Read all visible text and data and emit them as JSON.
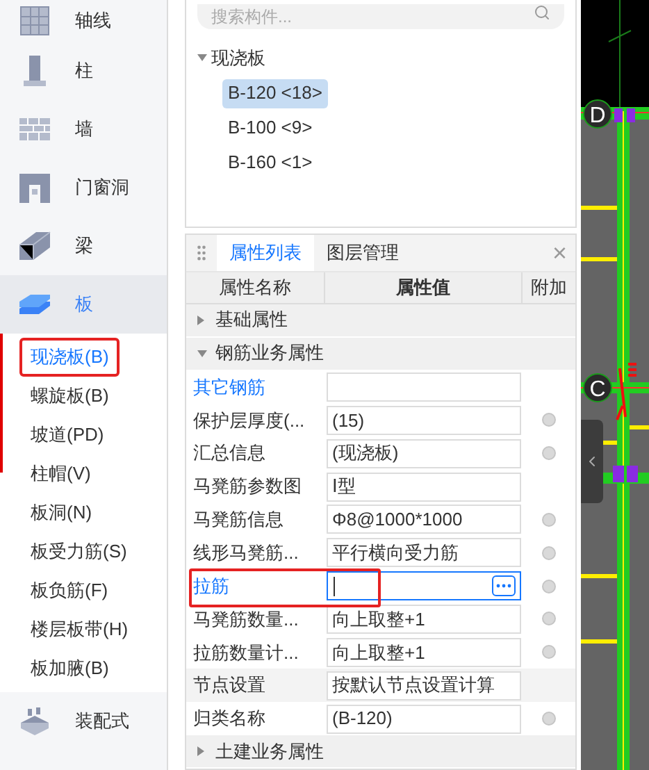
{
  "sidebar": {
    "categories": [
      {
        "label": "轴线",
        "kind": "grid",
        "selected": false
      },
      {
        "label": "柱",
        "kind": "column",
        "selected": false
      },
      {
        "label": "墙",
        "kind": "wall",
        "selected": false
      },
      {
        "label": "门窗洞",
        "kind": "door",
        "selected": false
      },
      {
        "label": "梁",
        "kind": "beam",
        "selected": false
      },
      {
        "label": "板",
        "kind": "slab",
        "selected": true,
        "children": [
          {
            "label": "现浇板(B)",
            "selected": true,
            "annotated": true
          },
          {
            "label": "螺旋板(B)",
            "selected": false,
            "annotated": false
          },
          {
            "label": "坡道(PD)",
            "selected": false,
            "annotated": false
          },
          {
            "label": "柱帽(V)",
            "selected": false,
            "annotated": false
          },
          {
            "label": "板洞(N)",
            "selected": false,
            "annotated": false
          },
          {
            "label": "板受力筋(S)",
            "selected": false,
            "annotated": false
          },
          {
            "label": "板负筋(F)",
            "selected": false,
            "annotated": false
          },
          {
            "label": "楼层板带(H)",
            "selected": false,
            "annotated": false
          },
          {
            "label": "板加腋(B)",
            "selected": false,
            "annotated": false
          }
        ]
      },
      {
        "label": "装配式",
        "kind": "prefab",
        "selected": false
      }
    ]
  },
  "component_list": {
    "search": {
      "placeholder": "搜索构件..."
    },
    "tree": {
      "label": "现浇板",
      "expanded": true,
      "children": [
        {
          "label": "B-120 <18>",
          "selected": true
        },
        {
          "label": "B-100 <9>",
          "selected": false
        },
        {
          "label": "B-160 <1>",
          "selected": false
        }
      ]
    }
  },
  "properties": {
    "tabs": [
      {
        "label": "属性列表",
        "selected": true
      },
      {
        "label": "图层管理",
        "selected": false
      }
    ],
    "close": "×",
    "columns": [
      "属性名称",
      "属性值",
      "附加"
    ],
    "rows": [
      {
        "kind": "group",
        "label": "基础属性",
        "expanded": false
      },
      {
        "kind": "group",
        "label": "钢筋业务属性",
        "expanded": true
      },
      {
        "kind": "prop",
        "name": "其它钢筋",
        "value": "",
        "highlight": true,
        "attach": false,
        "editing": false,
        "annotated": false,
        "shaded": false
      },
      {
        "kind": "prop",
        "name": "保护层厚度(...",
        "value": "(15)",
        "highlight": false,
        "attach": true,
        "editing": false,
        "annotated": false,
        "shaded": false
      },
      {
        "kind": "prop",
        "name": "汇总信息",
        "value": "(现浇板)",
        "highlight": false,
        "attach": true,
        "editing": false,
        "annotated": false,
        "shaded": false
      },
      {
        "kind": "prop",
        "name": "马凳筋参数图",
        "value": "Ⅰ型",
        "highlight": false,
        "attach": false,
        "editing": false,
        "annotated": false,
        "shaded": false
      },
      {
        "kind": "prop",
        "name": "马凳筋信息",
        "value": "Φ8@1000*1000",
        "highlight": false,
        "attach": true,
        "editing": false,
        "annotated": false,
        "shaded": false
      },
      {
        "kind": "prop",
        "name": "线形马凳筋...",
        "value": "平行横向受力筋",
        "highlight": false,
        "attach": true,
        "editing": false,
        "annotated": false,
        "shaded": false
      },
      {
        "kind": "prop",
        "name": "拉筋",
        "value": "",
        "highlight": true,
        "attach": true,
        "editing": true,
        "annotated": true,
        "shaded": false
      },
      {
        "kind": "prop",
        "name": "马凳筋数量...",
        "value": "向上取整+1",
        "highlight": false,
        "attach": true,
        "editing": false,
        "annotated": false,
        "shaded": false
      },
      {
        "kind": "prop",
        "name": "拉筋数量计...",
        "value": "向上取整+1",
        "highlight": false,
        "attach": true,
        "editing": false,
        "annotated": false,
        "shaded": false
      },
      {
        "kind": "prop",
        "name": "节点设置",
        "value": "按默认节点设置计算",
        "highlight": false,
        "attach": false,
        "editing": false,
        "annotated": false,
        "shaded": true
      },
      {
        "kind": "prop",
        "name": "归类名称",
        "value": "(B-120)",
        "highlight": false,
        "attach": true,
        "editing": false,
        "annotated": false,
        "shaded": false
      },
      {
        "kind": "group",
        "label": "土建业务属性",
        "expanded": false
      }
    ]
  },
  "canvas": {
    "axis_labels": [
      "D",
      "C"
    ]
  }
}
